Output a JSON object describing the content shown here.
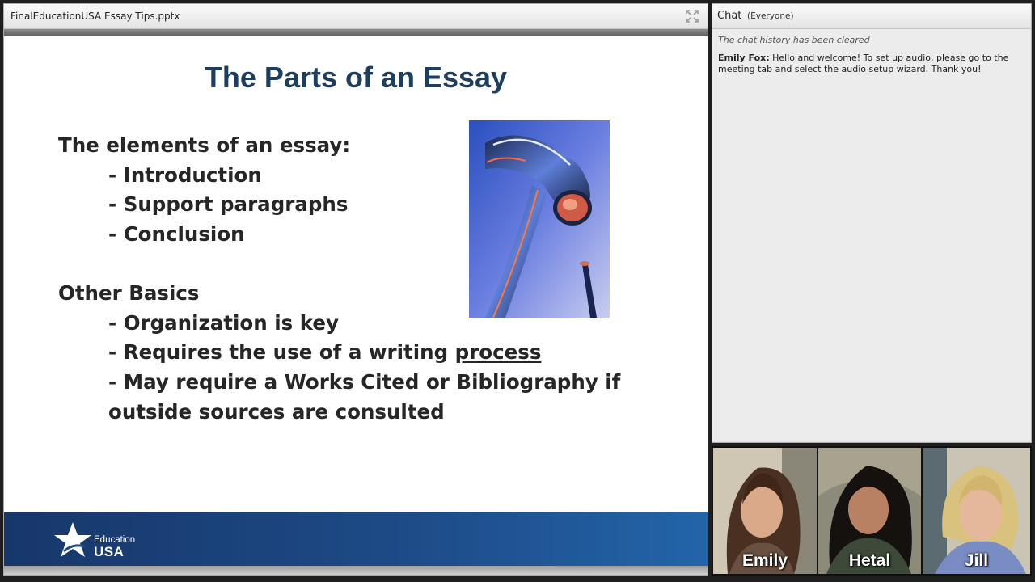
{
  "share_pod": {
    "title": "FinalEducationUSA Essay Tips.pptx"
  },
  "slide": {
    "title": "The Parts of an Essay",
    "elements_heading": "The elements of an essay:",
    "elements": [
      "- Introduction",
      "- Support paragraphs",
      "- Conclusion"
    ],
    "basics_heading": "Other Basics",
    "basics_1": "- Organization is key",
    "basics_2_prefix": "- Requires the use of a writing ",
    "basics_2_link": "process",
    "basics_3_line1": "- May require a Works Cited or Bibliography if",
    "basics_3_line2": "outside sources are consulted",
    "image_icon": "hammer-and-nail-image",
    "footer_logo_small": "Education",
    "footer_logo_big": "USA"
  },
  "chat": {
    "title": "Chat",
    "scope": "(Everyone)",
    "cleared_notice": "The chat history has been cleared",
    "message_author": "Emily Fox:",
    "message_text": "Hello and welcome! To set up audio, please go to the meeting tab and select the audio setup wizard. Thank you!"
  },
  "video": {
    "participants": [
      "Emily",
      "Hetal",
      "Jill"
    ]
  },
  "colors": {
    "slide_title": "#1d3e5e",
    "footer_band": "#1d4a86"
  }
}
